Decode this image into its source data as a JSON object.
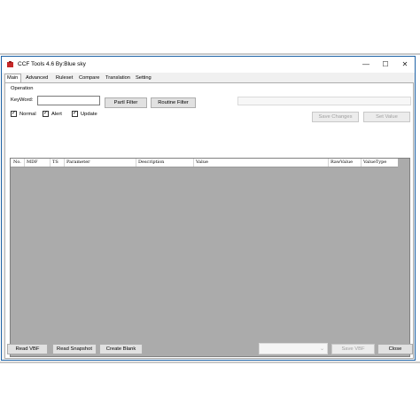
{
  "window": {
    "title": "CCF Tools 4.6   By:Blue sky"
  },
  "controls": {
    "minimize": "—",
    "maximize": "☐",
    "close": "✕"
  },
  "tabs": [
    "Main",
    "Advanced",
    "Ruleset",
    "Compare",
    "Translation",
    "Setting"
  ],
  "operation": {
    "group_label": "Operation",
    "keyword_label": "KeyWord:",
    "keyword_value": "",
    "partial_filter": "PartI Filter",
    "routine_filter": "Routine Filter",
    "checkboxes": [
      {
        "label": "Normal",
        "checked": true
      },
      {
        "label": "Alert",
        "checked": true
      },
      {
        "label": "Update",
        "checked": true
      }
    ],
    "save_changes": "Save Changes",
    "set_value": "Set Value"
  },
  "grid": {
    "columns": [
      "No.",
      "MDF",
      "TS",
      "Parameter",
      "Description",
      "Value",
      "RawValue",
      "ValueType"
    ]
  },
  "footer": {
    "read_vbf": "Read VBF",
    "read_snapshot": "Read Snapshot",
    "create_blank": "Create Blank",
    "save_vbf": "Save VBF",
    "close": "Close"
  },
  "icons": {
    "app": "toolbox-icon",
    "dropdown": "chevron-down-icon"
  }
}
